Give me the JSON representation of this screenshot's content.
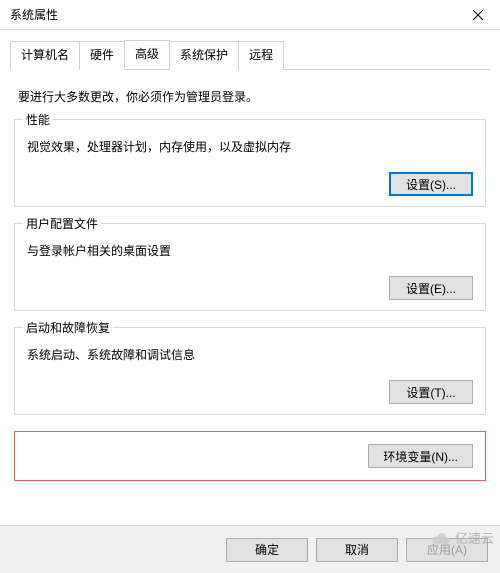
{
  "window": {
    "title": "系统属性"
  },
  "tabs": {
    "items": [
      {
        "label": "计算机名"
      },
      {
        "label": "硬件"
      },
      {
        "label": "高级"
      },
      {
        "label": "系统保护"
      },
      {
        "label": "远程"
      }
    ],
    "activeIndex": 2
  },
  "intro": "要进行大多数更改，你必须作为管理员登录。",
  "groups": {
    "performance": {
      "title": "性能",
      "desc": "视觉效果，处理器计划，内存使用，以及虚拟内存",
      "button": "设置(S)..."
    },
    "userprofile": {
      "title": "用户配置文件",
      "desc": "与登录帐户相关的桌面设置",
      "button": "设置(E)..."
    },
    "startup": {
      "title": "启动和故障恢复",
      "desc": "系统启动、系统故障和调试信息",
      "button": "设置(T)..."
    }
  },
  "env_button": "环境变量(N)...",
  "footer": {
    "ok": "确定",
    "cancel": "取消",
    "apply": "应用(A)"
  },
  "watermark": "亿速云"
}
